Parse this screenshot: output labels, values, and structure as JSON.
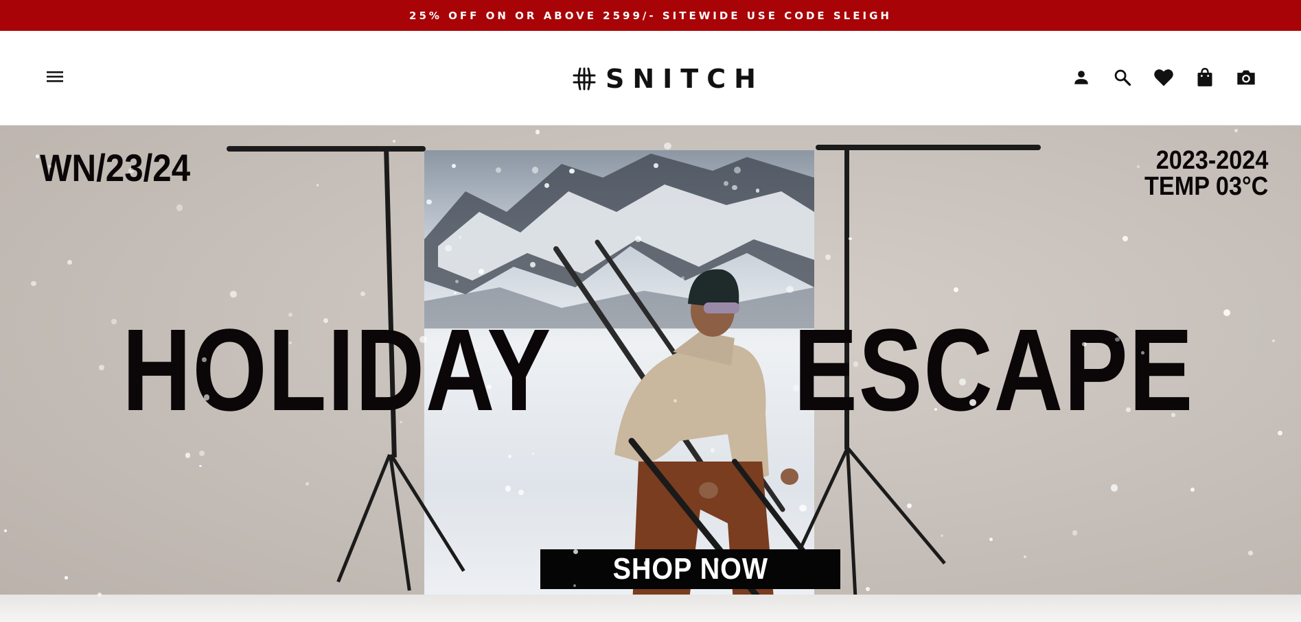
{
  "promo": {
    "text": "25% OFF ON OR ABOVE 2599/- SITEWIDE USE CODE SLEIGH"
  },
  "header": {
    "brand": "SNITCH",
    "icons": [
      "menu-icon",
      "user-icon",
      "search-icon",
      "heart-icon",
      "shopping-bag-icon",
      "camera-icon"
    ]
  },
  "hero": {
    "season": "WN/23/24",
    "year": "2023-2024",
    "temp": "TEMP 03°C",
    "headline_left": "HOLIDAY",
    "headline_right": "ESCAPE",
    "cta": "SHOP NOW"
  },
  "colors": {
    "promo_bg": "#a80407",
    "text_dark": "#0b0708",
    "cta_bg": "#050505"
  }
}
